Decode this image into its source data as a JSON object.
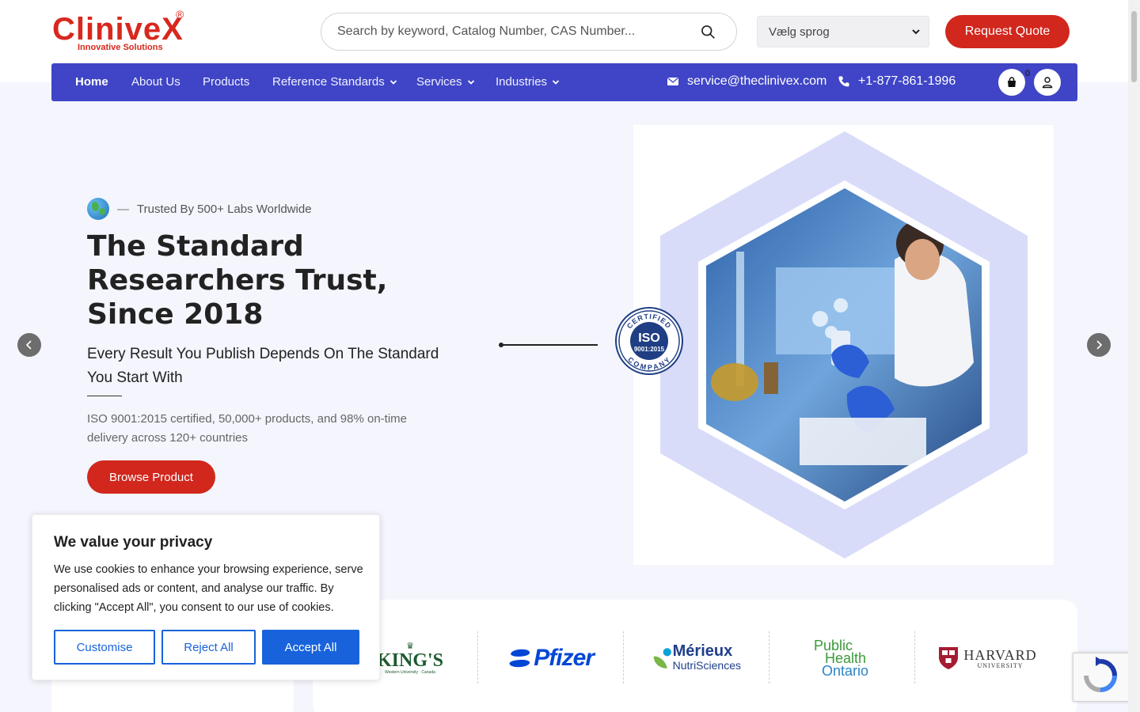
{
  "brand": {
    "logo_text": "ClinivеX",
    "logo_first": "Clinive",
    "logo_last": "X",
    "logo_reg": "®",
    "tagline": "Innovative Solutions"
  },
  "header": {
    "search_placeholder": "Search by keyword, Catalog Number, CAS Number...",
    "language_selected": "Vælg sprog",
    "request_quote": "Request Quote"
  },
  "nav": {
    "items": [
      {
        "label": "Home",
        "active": true,
        "dropdown": false
      },
      {
        "label": "About Us",
        "dropdown": false
      },
      {
        "label": "Products",
        "dropdown": false
      },
      {
        "label": "Reference Standards",
        "dropdown": true
      },
      {
        "label": "Services",
        "dropdown": true
      },
      {
        "label": "Industries",
        "dropdown": true
      }
    ],
    "email": "service@theclinivex.com",
    "phone": "+1-877-861-1996",
    "cart_count": "0"
  },
  "hero": {
    "trusted": "Trusted By 500+ Labs Worldwide",
    "title": "The Standard Researchers Trust, Since 2018",
    "subtitle": "Every Result You Publish Depends On The Standard You Start With",
    "description": "ISO 9001:2015 certified, 50,000+ products, and 98% on-time delivery across 120+ countries",
    "cta": "Browse Product",
    "badge": {
      "top": "CERTIFIED",
      "main": "ISO",
      "std": "9001:2015",
      "bottom": "COMPANY"
    }
  },
  "cookie": {
    "title": "We value your privacy",
    "text": "We use cookies to enhance your browsing experience, serve personalised ads or content, and analyse our traffic. By clicking \"Accept All\", you consent to our use of cookies.",
    "customise": "Customise",
    "reject": "Reject All",
    "accept": "Accept All"
  },
  "partners": {
    "kings": "KING'S",
    "kings_sub": "Western University · Canada",
    "pfizer": "Pfizer",
    "merieux_1": "Mérieux",
    "merieux_2": "NutriSciences",
    "pho_1": "Public",
    "pho_2": "Health",
    "pho_3": "Ontario",
    "harvard_1": "HARVARD",
    "harvard_2": "UNIVERSITY"
  },
  "colors": {
    "brand_red": "#d1271d",
    "nav_blue": "#3f45c6",
    "cookie_blue": "#1863dc",
    "hero_bg": "#f4f5fd"
  }
}
